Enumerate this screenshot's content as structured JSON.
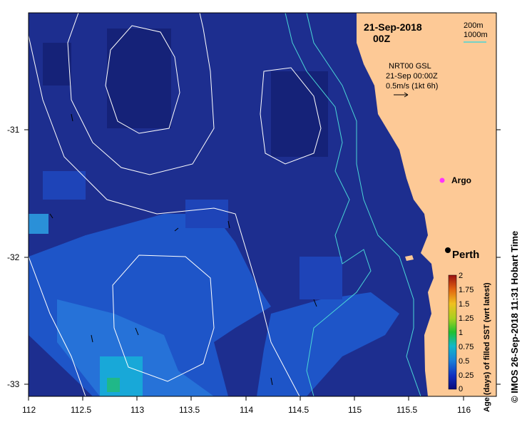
{
  "header": {
    "date": "21-Sep-2018",
    "time": "00Z"
  },
  "depth_legend": {
    "shallow": "200m",
    "deep": "1000m",
    "shallow_color": "#4ad6d6",
    "deep_color": "#4ad6d6"
  },
  "current": {
    "line1": "NRT00 GSL",
    "line2": "21-Sep 00:00Z",
    "line3": "0.5m/s (1kt 6h)"
  },
  "places": {
    "argo": "Argo",
    "perth": "Perth"
  },
  "axes": {
    "x_ticks": [
      "112",
      "112.5",
      "113",
      "113.5",
      "114",
      "114.5",
      "115",
      "115.5",
      "116"
    ],
    "y_ticks": [
      "-31",
      "-32",
      "-33"
    ]
  },
  "colorbar": {
    "title": "Age (days) of filled SST (wrt latest)",
    "ticks": [
      "2",
      "1.75",
      "1.5",
      "1.25",
      "1",
      "0.75",
      "0.5",
      "0.25",
      "0"
    ]
  },
  "credit": "© IMOS 26-Sep-2018 11:31 Hobart Time",
  "colors": {
    "ocean": "#1d2e8f",
    "land": "#fdc996",
    "contour": "#ffffff",
    "argo": "#ff33ff"
  }
}
